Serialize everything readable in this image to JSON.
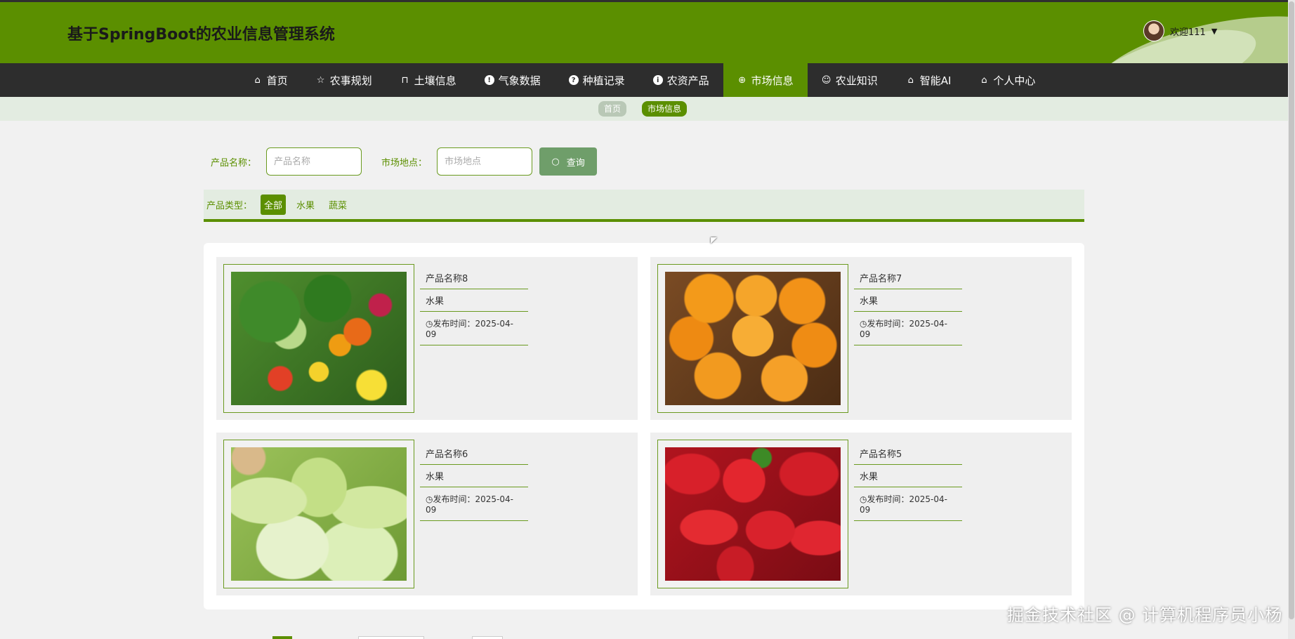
{
  "header": {
    "title": "基于SpringBoot的农业信息管理系统",
    "user_label": "欢迎111",
    "avatar_icon": "user-avatar",
    "caret_icon": "caret-down-icon"
  },
  "nav": {
    "items": [
      {
        "label": "首页",
        "icon": "home-icon"
      },
      {
        "label": "农事规划",
        "icon": "star-icon"
      },
      {
        "label": "土壤信息",
        "icon": "bag-icon"
      },
      {
        "label": "气象数据",
        "icon": "info-icon"
      },
      {
        "label": "种植记录",
        "icon": "help-icon"
      },
      {
        "label": "农资产品",
        "icon": "info-icon"
      },
      {
        "label": "市场信息",
        "icon": "globe-icon"
      },
      {
        "label": "农业知识",
        "icon": "smile-icon"
      },
      {
        "label": "智能AI",
        "icon": "home-icon"
      },
      {
        "label": "个人中心",
        "icon": "home-icon"
      }
    ],
    "active_index": 6
  },
  "breadcrumb": {
    "home": "首页",
    "current": "市场信息"
  },
  "search": {
    "name_label": "产品名称：",
    "name_placeholder": "产品名称",
    "location_label": "市场地点：",
    "location_placeholder": "市场地点",
    "button_label": "查询"
  },
  "type_filter": {
    "label": "产品类型：",
    "options": [
      "全部",
      "水果",
      "蔬菜"
    ],
    "active": "全部"
  },
  "products": [
    {
      "name": "产品名称8",
      "type": "水果",
      "publish": "发布时间：2025-04-09",
      "image": "vegetables"
    },
    {
      "name": "产品名称7",
      "type": "水果",
      "publish": "发布时间：2025-04-09",
      "image": "loquats"
    },
    {
      "name": "产品名称6",
      "type": "水果",
      "publish": "发布时间：2025-04-09",
      "image": "cabbage"
    },
    {
      "name": "产品名称5",
      "type": "水果",
      "publish": "发布时间：2025-04-09",
      "image": "strawberries"
    }
  ],
  "watermark": "掘金技术社区 @ 计算机程序员小杨",
  "colors": {
    "brand": "#5b8f00",
    "nav_bg": "#2d2d2d",
    "button": "#6f9e6a"
  }
}
